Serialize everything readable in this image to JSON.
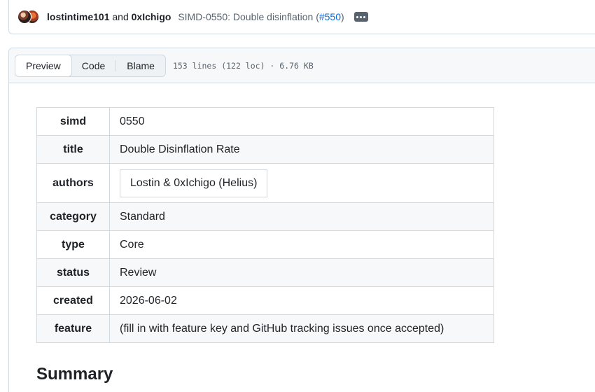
{
  "commit": {
    "author1": "lostintime101",
    "conjunction": "and",
    "author2": "0xIchigo",
    "message": "SIMD-0550: Double disinflation (",
    "pr": "#550",
    "message_end": ")"
  },
  "file_header": {
    "tabs": [
      "Preview",
      "Code",
      "Blame"
    ],
    "active_tab": "Preview",
    "meta": "153 lines (122 loc) · 6.76 KB"
  },
  "table": [
    {
      "key": "simd",
      "value": "0550"
    },
    {
      "key": "title",
      "value": "Double Disinflation Rate"
    },
    {
      "key": "authors",
      "value": "Lostin & 0xIchigo (Helius)"
    },
    {
      "key": "category",
      "value": "Standard"
    },
    {
      "key": "type",
      "value": "Core"
    },
    {
      "key": "status",
      "value": "Review"
    },
    {
      "key": "created",
      "value": "2026-06-02"
    },
    {
      "key": "feature",
      "value": "(fill in with feature key and GitHub tracking issues once accepted)"
    }
  ],
  "summary_heading": "Summary"
}
